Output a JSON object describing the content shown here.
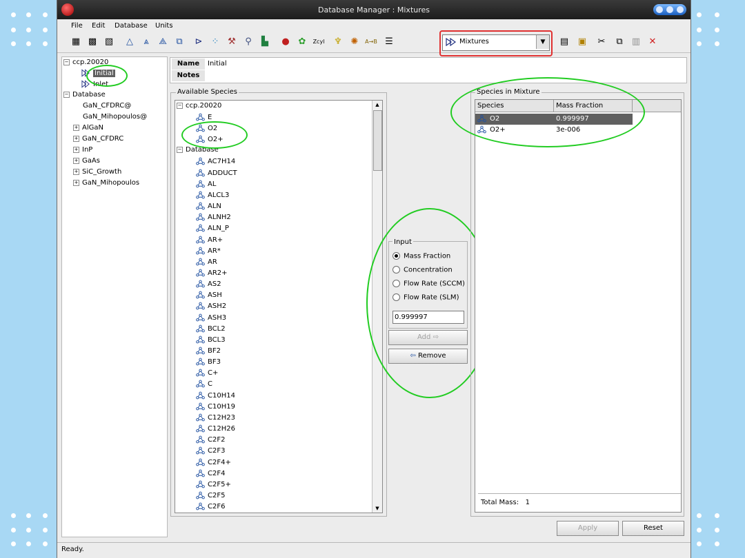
{
  "window": {
    "title": "Database Manager : Mixtures"
  },
  "menu": [
    "File",
    "Edit",
    "Database",
    "Units"
  ],
  "toolbar": {
    "icons": [
      "grid-icon",
      "grid-alt-icon",
      "grid-hatch-icon",
      "species-icon",
      "species-add-icon",
      "species-edit-icon",
      "species-copy-icon",
      "mixture-icon",
      "reaction-icon",
      "tool-icon",
      "molecule-icon",
      "surface-icon",
      "flask-icon",
      "globe-icon",
      "zcyl-label-icon",
      "lamp-icon",
      "mixer-icon",
      "arb-icon",
      "ladder-icon",
      "new-doc-icon",
      "open-folder-icon",
      "cut-icon",
      "copy-icon",
      "paste-icon",
      "delete-icon"
    ],
    "combo_value": "Mixtures"
  },
  "tree": {
    "root": "ccp.20020",
    "children": [
      "Initial",
      "Inlet"
    ],
    "database": "Database",
    "db_items": [
      {
        "label": "GaN_CFDRC@",
        "expandable": false
      },
      {
        "label": "GaN_Mihopoulos@",
        "expandable": false
      },
      {
        "label": "AlGaN",
        "expandable": true
      },
      {
        "label": "GaN_CFDRC",
        "expandable": true
      },
      {
        "label": "InP",
        "expandable": true
      },
      {
        "label": "GaAs",
        "expandable": true
      },
      {
        "label": "SiC_Growth",
        "expandable": true
      },
      {
        "label": "GaN_Mihopoulos",
        "expandable": true
      }
    ]
  },
  "form": {
    "name_label": "Name",
    "name_value": "Initial",
    "notes_label": "Notes",
    "notes_value": ""
  },
  "available": {
    "title": "Available Species",
    "group1": "ccp.20020",
    "group1_items": [
      "E",
      "O2",
      "O2+"
    ],
    "group2": "Database",
    "group2_items": [
      "AC7H14",
      "ADDUCT",
      "AL",
      "ALCL3",
      "ALN",
      "ALNH2",
      "ALN_P",
      "AR+",
      "AR*",
      "AR",
      "AR2+",
      "AS2",
      "ASH",
      "ASH2",
      "ASH3",
      "BCL2",
      "BCL3",
      "BF2",
      "BF3",
      "C+",
      "C",
      "C10H14",
      "C10H19",
      "C12H23",
      "C12H26",
      "C2F2",
      "C2F3",
      "C2F4+",
      "C2F4",
      "C2F5+",
      "C2F5",
      "C2F6"
    ]
  },
  "input": {
    "title": "Input",
    "options": [
      "Mass Fraction",
      "Concentration",
      "Flow Rate (SCCM)",
      "Flow Rate (SLM)"
    ],
    "selected": "Mass Fraction",
    "value": "0.999997",
    "add_label": "Add",
    "remove_label": "Remove"
  },
  "mixture": {
    "title": "Species in Mixture",
    "columns": [
      "Species",
      "Mass Fraction"
    ],
    "rows": [
      {
        "species": "O2",
        "fraction": "0.999997",
        "selected": true
      },
      {
        "species": "O2+",
        "fraction": "3e-006",
        "selected": false
      }
    ],
    "total_label": "Total Mass:",
    "total_value": "1"
  },
  "buttons": {
    "apply": "Apply",
    "reset": "Reset"
  },
  "status": "Ready.",
  "colors": {
    "highlight": "#22cc22",
    "callout": "#e03030",
    "selection": "#606060"
  }
}
